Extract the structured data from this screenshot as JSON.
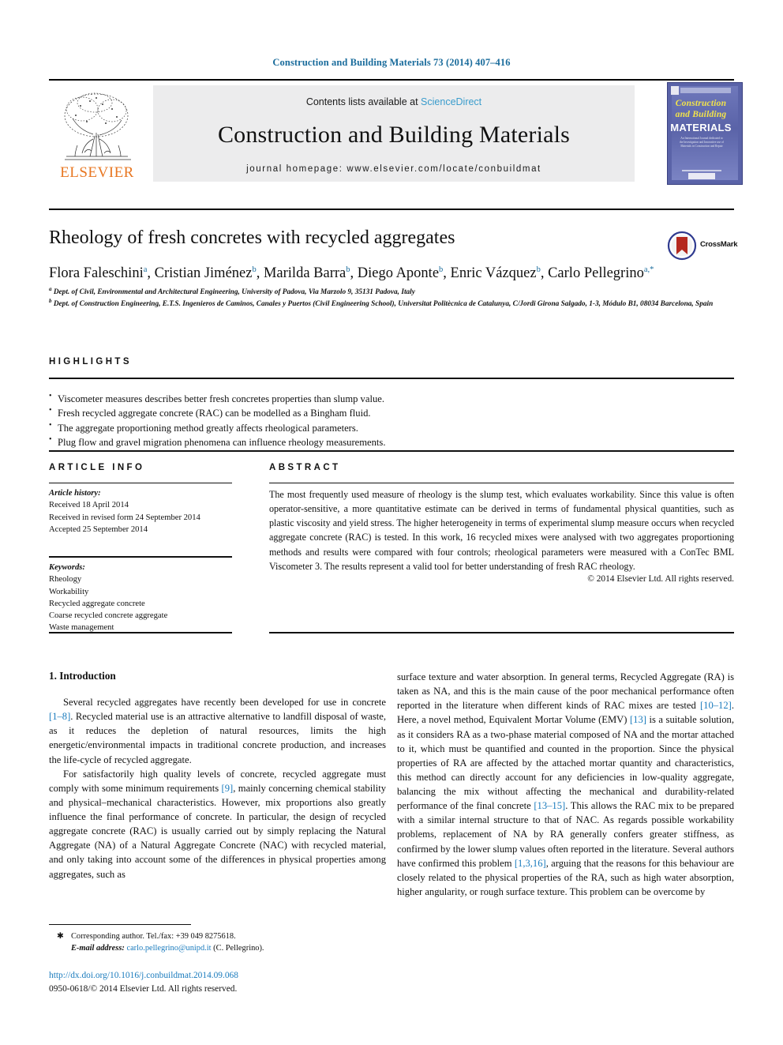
{
  "running_head": "Construction and Building Materials 73 (2014) 407–416",
  "masthead": {
    "contents_text": "Contents lists available at",
    "sciencedirect": "ScienceDirect",
    "journal_title": "Construction and Building Materials",
    "homepage": "journal homepage: www.elsevier.com/locate/conbuildmat",
    "publisher_logo_text": "ELSEVIER",
    "cover": {
      "line1": "Construction",
      "line2": "and Building",
      "line3": "MATERIALS",
      "blurb": "An International Journal dedicated to the Investigation and Innovative use of Materials in Construction and Repair"
    }
  },
  "article": {
    "title": "Rheology of fresh concretes with recycled aggregates",
    "crossmark_label": "CrossMark",
    "authors": [
      {
        "name": "Flora Faleschini",
        "sup": "a"
      },
      {
        "name": "Cristian Jiménez",
        "sup": "b"
      },
      {
        "name": "Marilda Barra",
        "sup": "b"
      },
      {
        "name": "Diego Aponte",
        "sup": "b"
      },
      {
        "name": "Enric Vázquez",
        "sup": "b"
      },
      {
        "name": "Carlo Pellegrino",
        "sup": "a,*"
      }
    ],
    "affiliations": [
      {
        "marker": "a",
        "text": "Dept. of Civil, Environmental and Architectural Engineering, University of Padova, Via Marzolo 9, 35131 Padova, Italy"
      },
      {
        "marker": "b",
        "text": "Dept. of Construction Engineering, E.T.S. Ingenieros de Caminos, Canales y Puertos (Civil Engineering School), Universitat Politècnica de Catalunya, C/Jordi Girona Salgado, 1-3, Módulo B1, 08034 Barcelona, Spain"
      }
    ]
  },
  "highlights": {
    "heading": "HIGHLIGHTS",
    "items": [
      "Viscometer measures describes better fresh concretes properties than slump value.",
      "Fresh recycled aggregate concrete (RAC) can be modelled as a Bingham fluid.",
      "The aggregate proportioning method greatly affects rheological parameters.",
      "Plug flow and gravel migration phenomena can influence rheology measurements."
    ]
  },
  "article_info": {
    "heading": "ARTICLE INFO",
    "history_label": "Article history:",
    "history": [
      "Received 18 April 2014",
      "Received in revised form 24 September 2014",
      "Accepted 25 September 2014"
    ],
    "keywords_label": "Keywords:",
    "keywords": [
      "Rheology",
      "Workability",
      "Recycled aggregate concrete",
      "Coarse recycled concrete aggregate",
      "Waste management"
    ]
  },
  "abstract": {
    "heading": "ABSTRACT",
    "text": "The most frequently used measure of rheology is the slump test, which evaluates workability. Since this value is often operator-sensitive, a more quantitative estimate can be derived in terms of fundamental physical quantities, such as plastic viscosity and yield stress. The higher heterogeneity in terms of experimental slump measure occurs when recycled aggregate concrete (RAC) is tested. In this work, 16 recycled mixes were analysed with two aggregates proportioning methods and results were compared with four controls; rheological parameters were measured with a ConTec BML Viscometer 3. The results represent a valid tool for better understanding of fresh RAC rheology.",
    "copyright": "© 2014 Elsevier Ltd. All rights reserved."
  },
  "body": {
    "section_title": "1. Introduction",
    "left_paragraphs": [
      {
        "parts": [
          {
            "t": "Several recycled aggregates have recently been developed for use in concrete "
          },
          {
            "t": "[1–8]",
            "ref": true
          },
          {
            "t": ". Recycled material use is an attractive alternative to landfill disposal of waste, as it reduces the depletion of natural resources, limits the high energetic/environmental impacts in traditional concrete production, and increases the life-cycle of recycled aggregate."
          }
        ]
      },
      {
        "parts": [
          {
            "t": "For satisfactorily high quality levels of concrete, recycled aggregate must comply with some minimum requirements "
          },
          {
            "t": "[9]",
            "ref": true
          },
          {
            "t": ", mainly concerning chemical stability and physical–mechanical characteristics. However, mix proportions also greatly influence the final performance of concrete. In particular, the design of recycled aggregate concrete (RAC) is usually carried out by simply replacing the Natural Aggregate (NA) of a Natural Aggregate Concrete (NAC) with recycled material, and only taking into account some of the differences in physical properties among aggregates, such as"
          }
        ]
      }
    ],
    "right_paragraphs": [
      {
        "parts": [
          {
            "t": "surface texture and water absorption. In general terms, Recycled Aggregate (RA) is taken as NA, and this is the main cause of the poor mechanical performance often reported in the literature when different kinds of RAC mixes are tested "
          },
          {
            "t": "[10–12]",
            "ref": true
          },
          {
            "t": ". Here, a novel method, Equivalent Mortar Volume (EMV) "
          },
          {
            "t": "[13]",
            "ref": true
          },
          {
            "t": " is a suitable solution, as it considers RA as a two-phase material composed of NA and the mortar attached to it, which must be quantified and counted in the proportion. Since the physical properties of RA are affected by the attached mortar quantity and characteristics, this method can directly account for any deficiencies in low-quality aggregate, balancing the mix without affecting the mechanical and durability-related performance of the final concrete "
          },
          {
            "t": "[13–15]",
            "ref": true
          },
          {
            "t": ". This allows the RAC mix to be prepared with a similar internal structure to that of NAC. As regards possible workability problems, replacement of NA by RA generally confers greater stiffness, as confirmed by the lower slump values often reported in the literature. Several authors have confirmed this problem "
          },
          {
            "t": "[1,3,16]",
            "ref": true
          },
          {
            "t": ", arguing that the reasons for this behaviour are closely related to the physical properties of the RA, such as high water absorption, higher angularity, or rough surface texture. This problem can be overcome by"
          }
        ]
      }
    ]
  },
  "footnotes": {
    "corresponding": "Corresponding author. Tel./fax: +39 049 8275618.",
    "email_label": "E-mail address:",
    "email": "carlo.pellegrino@unipd.it",
    "email_person": "(C. Pellegrino).",
    "doi": "http://dx.doi.org/10.1016/j.conbuildmat.2014.09.068",
    "issn_line": "0950-0618/© 2014 Elsevier Ltd. All rights reserved."
  }
}
